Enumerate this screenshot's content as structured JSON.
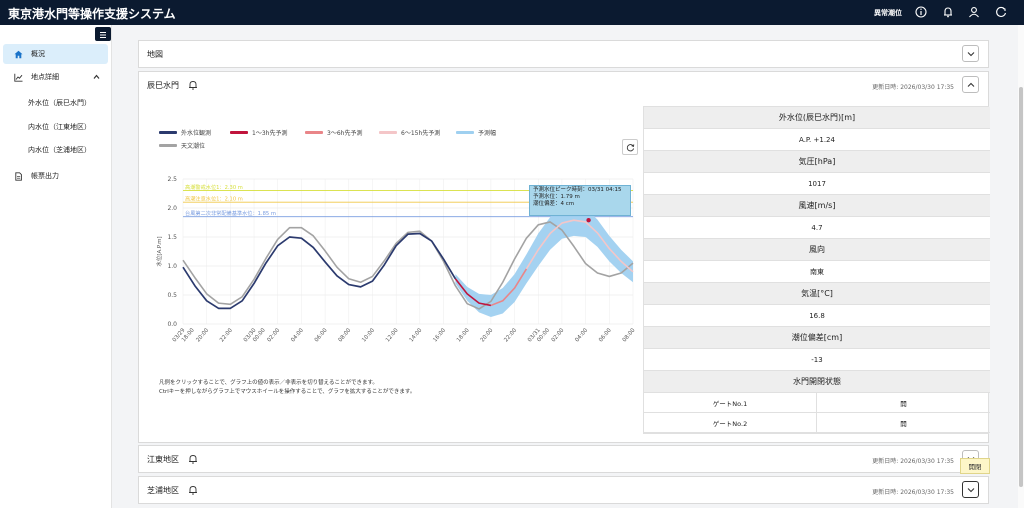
{
  "header": {
    "title": "東京港水門等操作支援システム",
    "alert_link": "異常潮位",
    "icons": [
      "info-icon",
      "bell-icon",
      "user-icon",
      "logout-icon"
    ]
  },
  "sidebar": {
    "items": [
      {
        "label": "概況",
        "icon": "home-icon"
      },
      {
        "label": "地点詳細",
        "icon": "chart-line-icon"
      },
      {
        "label": "外水位（辰巳水門）"
      },
      {
        "label": "内水位（江東地区）"
      },
      {
        "label": "内水位（芝浦地区）"
      },
      {
        "label": "帳票出力",
        "icon": "document-icon"
      }
    ]
  },
  "panels": {
    "map": {
      "title": "地図"
    },
    "tatsumi": {
      "title": "辰巳水門",
      "updated": "更新日時: 2026/03/30 17:35"
    },
    "koto": {
      "title": "江東地区",
      "updated": "更新日時: 2026/03/30 17:35"
    },
    "shibaura": {
      "title": "芝浦地区",
      "updated": "更新日時: 2026/03/30 17:35"
    }
  },
  "tooltip": "開閉",
  "chart_notes": [
    "凡例をクリックすることで、グラフ上の値の表示／非表示を切り替えることができます。",
    "Ctrlキーを押しながらグラフ上でマウスホイールを操作することで、グラフを拡大することができます。"
  ],
  "peak_box": [
    "予測水位ピーク時刻：03/31 04:15",
    "予測水位：1.79 m",
    "潮位偏差：4 cm"
  ],
  "info": {
    "rows": [
      {
        "label": "外水位(辰巳水門)[m]",
        "value": "A.P. +1.24"
      },
      {
        "label": "気圧[hPa]",
        "value": "1017"
      },
      {
        "label": "風速[m/s]",
        "value": "4.7"
      },
      {
        "label": "風向",
        "value": "南東"
      },
      {
        "label": "気温[°C]",
        "value": "16.8"
      },
      {
        "label": "潮位偏差[cm]",
        "value": "-13"
      }
    ],
    "gate_header": "水門開閉状態",
    "gates": [
      {
        "name": "ゲートNo.1",
        "state": "開"
      },
      {
        "name": "ゲートNo.2",
        "state": "開"
      }
    ]
  },
  "chart_data": {
    "type": "line",
    "legend": [
      {
        "name": "外水位観測",
        "color": "#2b3a6e"
      },
      {
        "name": "1〜3h先予測",
        "color": "#c0143c"
      },
      {
        "name": "3〜6h先予測",
        "color": "#e98588"
      },
      {
        "name": "6〜15h先予測",
        "color": "#f4c6c8"
      },
      {
        "name": "予測幅",
        "color": "#9fd0f0"
      },
      {
        "name": "天文潮位",
        "color": "#a3a3a3"
      }
    ],
    "ylabel": "水位[A.P.m]",
    "xlabel": "時刻[h]",
    "ylim": [
      0,
      2.5
    ],
    "yticks": [
      "0.0",
      "0.5",
      "1.0",
      "1.5",
      "2.0",
      "2.5"
    ],
    "xticks": [
      "03/29 18:00",
      "20:00",
      "22:00",
      "03/30 00:00",
      "02:00",
      "04:00",
      "06:00",
      "08:00",
      "10:00",
      "12:00",
      "14:00",
      "16:00",
      "18:00",
      "20:00",
      "22:00",
      "03/31 00:00",
      "02:00",
      "04:00",
      "06:00",
      "08:00"
    ],
    "thresholds": [
      {
        "label": "高潮警戒水位1：2.30 m",
        "value": 2.3,
        "color": "#d6df3a"
      },
      {
        "label": "高潮注意水位1：2.10 m",
        "value": 2.1,
        "color": "#f0c846"
      },
      {
        "label": "台風第二次非常配備基準水位：1.85 m",
        "value": 1.85,
        "color": "#7a9de0"
      }
    ],
    "x_hours_start": 0,
    "x_hours_end": 38,
    "peak": {
      "x_hours": 34.25,
      "y": 1.79
    },
    "series": {
      "astronomical": {
        "x": [
          0,
          1,
          2,
          3,
          4,
          5,
          6,
          7,
          8,
          9,
          10,
          11,
          12,
          13,
          14,
          15,
          16,
          17,
          18,
          19,
          20,
          21,
          22,
          23,
          24,
          25,
          26,
          27,
          28,
          29,
          30,
          31,
          32,
          33,
          34,
          35,
          36,
          37,
          38
        ],
        "y": [
          1.1,
          0.8,
          0.52,
          0.36,
          0.34,
          0.47,
          0.77,
          1.13,
          1.46,
          1.66,
          1.66,
          1.52,
          1.26,
          0.98,
          0.78,
          0.72,
          0.82,
          1.09,
          1.39,
          1.58,
          1.6,
          1.43,
          1.08,
          0.66,
          0.35,
          0.26,
          0.39,
          0.72,
          1.12,
          1.48,
          1.71,
          1.76,
          1.62,
          1.34,
          1.04,
          0.88,
          0.82,
          0.88,
          1.05
        ]
      },
      "observed": {
        "x": [
          0,
          1,
          2,
          3,
          4,
          5,
          6,
          7,
          8,
          9,
          10,
          11,
          12,
          13,
          14,
          15,
          16,
          17,
          18,
          19,
          20,
          21,
          22,
          23
        ],
        "y": [
          0.98,
          0.66,
          0.4,
          0.27,
          0.27,
          0.4,
          0.7,
          1.05,
          1.35,
          1.5,
          1.48,
          1.32,
          1.07,
          0.83,
          0.68,
          0.64,
          0.74,
          1.02,
          1.35,
          1.55,
          1.56,
          1.43,
          1.12,
          0.78
        ]
      },
      "pred_1_3h": {
        "x": [
          23,
          24,
          25,
          26
        ],
        "y": [
          0.78,
          0.52,
          0.36,
          0.32
        ]
      },
      "pred_3_6h": {
        "x": [
          26,
          27,
          28,
          29
        ],
        "y": [
          0.32,
          0.4,
          0.62,
          0.95
        ]
      },
      "pred_6_15h": {
        "x": [
          29,
          30,
          31,
          32,
          33,
          34,
          35,
          36,
          37,
          38
        ],
        "y": [
          0.95,
          1.28,
          1.56,
          1.74,
          1.79,
          1.76,
          1.57,
          1.3,
          1.08,
          0.9
        ]
      },
      "band_upper": {
        "x": [
          23,
          24,
          25,
          26,
          27,
          28,
          29,
          30,
          31,
          32,
          33,
          34,
          35,
          36,
          37,
          38
        ],
        "y": [
          0.86,
          0.64,
          0.52,
          0.5,
          0.62,
          0.86,
          1.2,
          1.56,
          1.84,
          2.01,
          2.05,
          2.0,
          1.8,
          1.52,
          1.28,
          1.08
        ]
      },
      "band_lower": {
        "x": [
          23,
          24,
          25,
          26,
          27,
          28,
          29,
          30,
          31,
          32,
          33,
          34,
          35,
          36,
          37,
          38
        ],
        "y": [
          0.7,
          0.4,
          0.2,
          0.12,
          0.18,
          0.38,
          0.7,
          1.0,
          1.28,
          1.47,
          1.52,
          1.5,
          1.33,
          1.08,
          0.88,
          0.72
        ]
      }
    }
  }
}
